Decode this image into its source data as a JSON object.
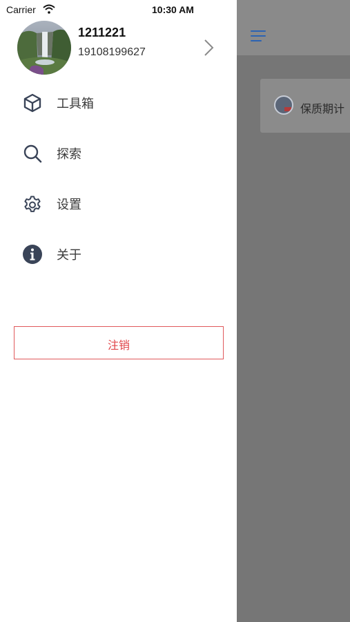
{
  "status_bar": {
    "carrier": "Carrier",
    "time": "10:30 AM"
  },
  "profile": {
    "name": "1211221",
    "phone": "19108199627"
  },
  "menu": [
    {
      "label": "工具箱",
      "icon": "cube-icon"
    },
    {
      "label": "探索",
      "icon": "search-icon"
    },
    {
      "label": "设置",
      "icon": "gear-icon"
    },
    {
      "label": "关于",
      "icon": "info-icon"
    }
  ],
  "logout_label": "注销",
  "background_screen": {
    "card_text": "保质期计"
  },
  "colors": {
    "accent": "#2b63b3",
    "danger": "#e04448",
    "overlay": "#767676"
  }
}
